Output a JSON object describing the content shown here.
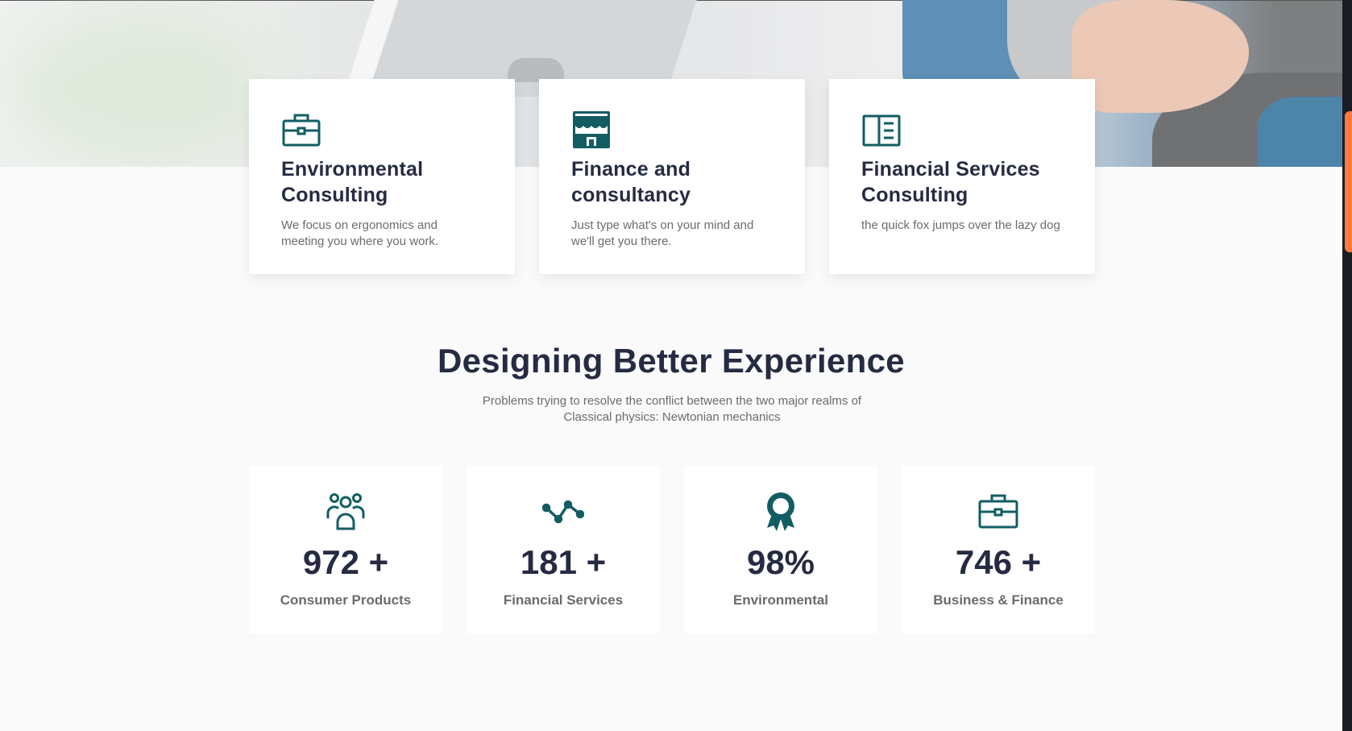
{
  "services": [
    {
      "icon": "briefcase-icon",
      "title": "Environmental Consulting",
      "description": "We focus on ergonomics and meeting you where you work."
    },
    {
      "icon": "storefront-icon",
      "title": "Finance and consultancy",
      "description": "Just type what's on your mind and we'll get you there."
    },
    {
      "icon": "book-icon",
      "title": "Financial Services Consulting",
      "description": "the quick fox jumps over the lazy dog"
    }
  ],
  "section": {
    "title": "Designing Better Experience",
    "subtitle": "Problems trying to resolve the conflict between the two major realms of Classical physics: Newtonian mechanics"
  },
  "stats": [
    {
      "icon": "users-icon",
      "value": "972 +",
      "label": "Consumer Products"
    },
    {
      "icon": "trend-line-icon",
      "value": "181 +",
      "label": "Financial Services"
    },
    {
      "icon": "award-icon",
      "value": "98%",
      "label": "Environmental"
    },
    {
      "icon": "briefcase-icon",
      "value": "746 +",
      "label": "Business & Finance"
    }
  ],
  "colors": {
    "accent": "#125d63",
    "heading": "#252b42",
    "text": "#6b6b6b",
    "background": "#fafafa",
    "scrollbar_thumb": "#ff7a3d"
  }
}
